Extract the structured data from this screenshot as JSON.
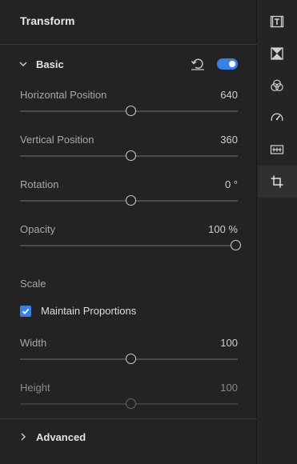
{
  "panel": {
    "title": "Transform",
    "basic": {
      "label": "Basic",
      "expanded": true,
      "enabled": true,
      "properties": [
        {
          "label": "Horizontal Position",
          "value": "640",
          "fraction": 0.51
        },
        {
          "label": "Vertical Position",
          "value": "360",
          "fraction": 0.51
        },
        {
          "label": "Rotation",
          "value": "0 °",
          "fraction": 0.51
        },
        {
          "label": "Opacity",
          "value": "100 %",
          "fraction": 1.0
        }
      ],
      "scale": {
        "label": "Scale",
        "maintain_proportions": {
          "label": "Maintain Proportions",
          "checked": true
        },
        "width": {
          "label": "Width",
          "value": "100",
          "fraction": 0.51
        },
        "height": {
          "label": "Height",
          "value": "100",
          "fraction": 0.51
        }
      }
    },
    "advanced": {
      "label": "Advanced",
      "expanded": false
    }
  },
  "rail": {
    "items": [
      {
        "icon": "titles-icon"
      },
      {
        "icon": "transitions-icon"
      },
      {
        "icon": "color-icon"
      },
      {
        "icon": "speed-icon"
      },
      {
        "icon": "audio-track-icon"
      },
      {
        "icon": "crop-transform-icon",
        "active": true
      }
    ]
  },
  "colors": {
    "accent": "#3b80e6",
    "background": "#232323"
  }
}
